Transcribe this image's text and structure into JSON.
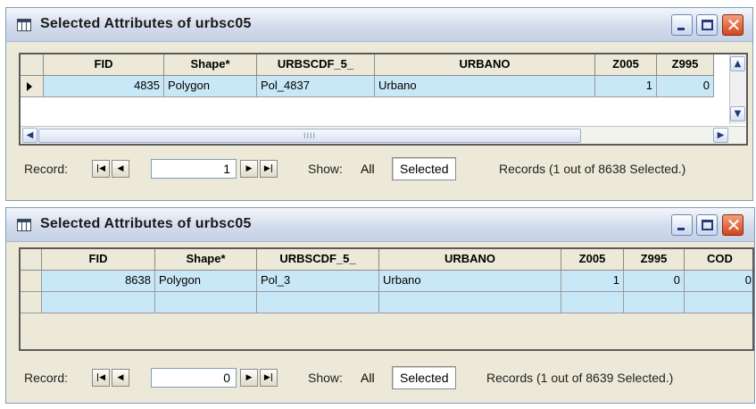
{
  "windows": [
    {
      "title": "Selected Attributes of urbsc05",
      "columns": [
        "",
        "FID",
        "Shape*",
        "URBSCDF_5_",
        "URBANO",
        "Z005",
        "Z995"
      ],
      "row": {
        "FID": "4835",
        "Shape": "Polygon",
        "URBSCDF": "Pol_4837",
        "URBANO": "Urbano",
        "Z005": "1",
        "Z995": "0"
      },
      "scroll_thumb": "IIII",
      "record_label": "Record:",
      "record_value": "1",
      "show_label": "Show:",
      "all_label": "All",
      "selected_label": "Selected",
      "records_text": "Records (1 out of 8638 Selected.)"
    },
    {
      "title": "Selected Attributes of urbsc05",
      "columns": [
        "",
        "FID",
        "Shape*",
        "URBSCDF_5_",
        "URBANO",
        "Z005",
        "Z995",
        "COD"
      ],
      "row": {
        "FID": "8638",
        "Shape": "Polygon",
        "URBSCDF": "Pol_3",
        "URBANO": "Urbano",
        "Z005": "1",
        "Z995": "0",
        "COD": "0"
      },
      "record_label": "Record:",
      "record_value": "0",
      "show_label": "Show:",
      "all_label": "All",
      "selected_label": "Selected",
      "records_text": "Records (1 out of 8639 Selected.)"
    }
  ],
  "icons": {
    "table": "table-icon",
    "minimize": "minimize-icon",
    "maximize": "maximize-icon",
    "close": "close-icon",
    "first": "first-record-icon",
    "prev": "previous-record-icon",
    "next": "next-record-icon",
    "last": "last-record-icon"
  },
  "colors": {
    "selected_row": "#c9e8f7",
    "window_bg": "#ece9d8",
    "close_button": "#d2451e"
  }
}
